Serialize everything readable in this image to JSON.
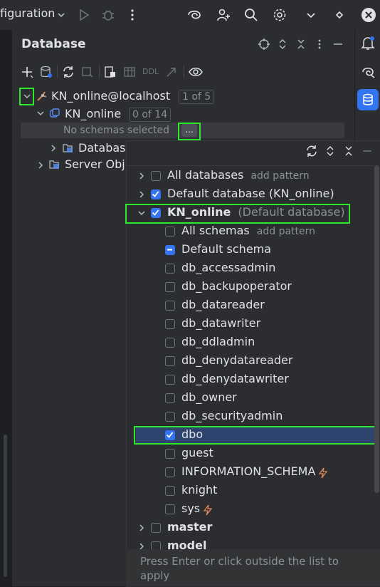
{
  "topbar": {
    "title": "figuration",
    "icons": [
      "chevron-down-icon",
      "run-icon",
      "debug-icon",
      "more-vertical-icon",
      "ai-assistant-icon",
      "add-user-icon",
      "search-icon",
      "gear-icon",
      "chevron-down-icon",
      "diamond-icon",
      "close-icon"
    ]
  },
  "panel": {
    "title": "Database",
    "header_icons": [
      "crosshair-icon",
      "expand-icon",
      "collapse-icon",
      "more-vertical-icon",
      "minimize-icon"
    ],
    "toolbar_icons": [
      "add-icon",
      "datasource-properties-icon",
      "refresh-icon",
      "stop-icon",
      "jump-to-console-icon",
      "table-icon",
      "ddl-icon",
      "jump-to-source-icon",
      "view-icon"
    ],
    "toolbar_ddl_label": "DDL"
  },
  "tree": {
    "root_label": "KN_online@localhost",
    "root_badge": "1 of 5",
    "db_label": "KN_online",
    "db_badge": "0 of 14",
    "no_schemas": "No schemas selected",
    "ellipsis_button": "...",
    "databases_label": "Databas",
    "server_objects_label": "Server Obj"
  },
  "popup": {
    "header_icons": [
      "refresh-icon",
      "expand-icon",
      "collapse-icon",
      "minimize-icon"
    ],
    "rows": [
      {
        "label": "All databases",
        "hint": "add pattern",
        "checked": "off",
        "bold": false,
        "indent": 0,
        "chevron": "right"
      },
      {
        "label": "Default database (KN_online)",
        "hint": "",
        "checked": "on",
        "bold": false,
        "indent": 0,
        "chevron": "right"
      },
      {
        "label": "KN_online",
        "hint": "(Default database)",
        "checked": "on",
        "bold": true,
        "indent": 0,
        "chevron": "down"
      },
      {
        "label": "All schemas",
        "hint": "add pattern",
        "checked": "off",
        "bold": false,
        "indent": 1,
        "chevron": ""
      },
      {
        "label": "Default schema",
        "hint": "",
        "checked": "partial",
        "bold": false,
        "indent": 1,
        "chevron": ""
      },
      {
        "label": "db_accessadmin",
        "hint": "",
        "checked": "off",
        "bold": false,
        "indent": 1,
        "chevron": ""
      },
      {
        "label": "db_backupoperator",
        "hint": "",
        "checked": "off",
        "bold": false,
        "indent": 1,
        "chevron": ""
      },
      {
        "label": "db_datareader",
        "hint": "",
        "checked": "off",
        "bold": false,
        "indent": 1,
        "chevron": ""
      },
      {
        "label": "db_datawriter",
        "hint": "",
        "checked": "off",
        "bold": false,
        "indent": 1,
        "chevron": ""
      },
      {
        "label": "db_ddladmin",
        "hint": "",
        "checked": "off",
        "bold": false,
        "indent": 1,
        "chevron": ""
      },
      {
        "label": "db_denydatareader",
        "hint": "",
        "checked": "off",
        "bold": false,
        "indent": 1,
        "chevron": ""
      },
      {
        "label": "db_denydatawriter",
        "hint": "",
        "checked": "off",
        "bold": false,
        "indent": 1,
        "chevron": ""
      },
      {
        "label": "db_owner",
        "hint": "",
        "checked": "off",
        "bold": false,
        "indent": 1,
        "chevron": ""
      },
      {
        "label": "db_securityadmin",
        "hint": "",
        "checked": "off",
        "bold": false,
        "indent": 1,
        "chevron": ""
      },
      {
        "label": "dbo",
        "hint": "",
        "checked": "on",
        "bold": false,
        "indent": 1,
        "chevron": "",
        "selected": true
      },
      {
        "label": "guest",
        "hint": "",
        "checked": "off",
        "bold": false,
        "indent": 1,
        "chevron": ""
      },
      {
        "label": "INFORMATION_SCHEMA",
        "hint": "",
        "checked": "off",
        "bold": false,
        "indent": 1,
        "chevron": "",
        "lightning": true
      },
      {
        "label": "knight",
        "hint": "",
        "checked": "off",
        "bold": false,
        "indent": 1,
        "chevron": ""
      },
      {
        "label": "sys",
        "hint": "",
        "checked": "off",
        "bold": false,
        "indent": 1,
        "chevron": "",
        "lightning": true
      },
      {
        "label": "master",
        "hint": "",
        "checked": "off",
        "bold": true,
        "indent": 0,
        "chevron": "right"
      },
      {
        "label": "model",
        "hint": "",
        "checked": "off",
        "bold": true,
        "indent": 0,
        "chevron": "right"
      }
    ],
    "footer": "Press Enter or click outside the list to apply"
  },
  "rightbar": {
    "icons": [
      "notifications-icon",
      "ai-chat-icon",
      "database-icon"
    ]
  },
  "colors": {
    "accent": "#3574f0",
    "highlight": "#2ee82e",
    "selected_row": "#2e436e",
    "background": "#2b2d30",
    "lightning": "#e08855"
  }
}
